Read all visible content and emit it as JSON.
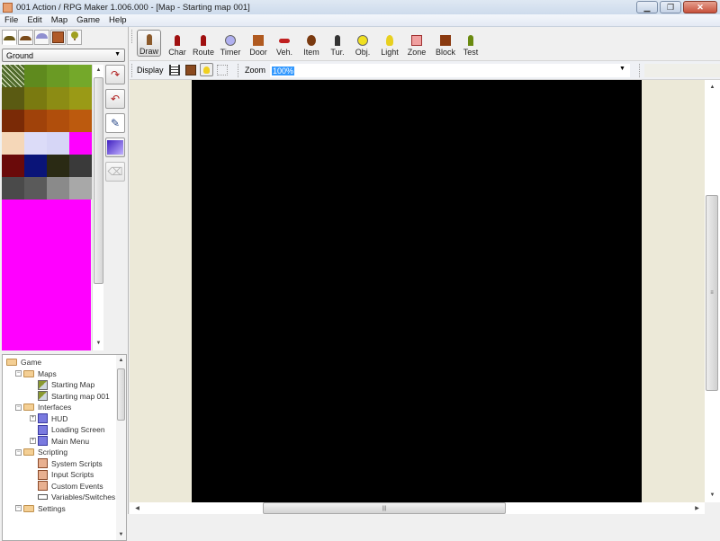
{
  "window": {
    "title": "001 Action / RPG Maker 1.006.000 - [Map - Starting map 001]",
    "minimize_icon": "minimize-icon",
    "restore_icon": "restore-icon",
    "close_icon": "close-icon"
  },
  "menu": [
    "File",
    "Edit",
    "Map",
    "Game",
    "Help"
  ],
  "left_panel": {
    "tile_tabs": [
      "ground-tab-icon",
      "hill-tab-icon",
      "platform-tab-icon",
      "wall-tab-icon",
      "tree-tab-icon"
    ],
    "layer_select": "Ground",
    "palette_colors": [
      [
        "#4f6a2a",
        "#5f8a1e",
        "#6a9a24",
        "#74a82a"
      ],
      [
        "#5a5a12",
        "#7a7a10",
        "#8c8c14",
        "#9a9a16"
      ],
      [
        "#7a2a06",
        "#a0420a",
        "#b04e0c",
        "#bc5a0e"
      ],
      [
        "#f5d7b8",
        "#dcdcf8",
        "#d6d6f6",
        "#ff00ff"
      ],
      [
        "#6a0a0a",
        "#0a1478",
        "#2a2a14",
        "#3a3a3a"
      ],
      [
        "#4a4a4a",
        "#5a5a5a",
        "#8a8a8a",
        "#a8a8a8"
      ]
    ],
    "tools": [
      "flip-horizontal-icon",
      "flip-vertical-icon",
      "pencil-icon",
      "fill-icon",
      "eraser-icon"
    ]
  },
  "tree": [
    {
      "label": "Game",
      "icon": "folder-icon",
      "level": 0,
      "expander": ""
    },
    {
      "label": "Maps",
      "icon": "folder-icon",
      "level": 1,
      "expander": "−"
    },
    {
      "label": "Starting Map",
      "icon": "map-icon",
      "level": 2,
      "expander": ""
    },
    {
      "label": "Starting map 001",
      "icon": "map-icon",
      "level": 2,
      "expander": ""
    },
    {
      "label": "Interfaces",
      "icon": "folder-icon",
      "level": 1,
      "expander": "−"
    },
    {
      "label": "HUD",
      "icon": "interface-icon",
      "level": 2,
      "expander": "+"
    },
    {
      "label": "Loading Screen",
      "icon": "interface-icon",
      "level": 2,
      "expander": ""
    },
    {
      "label": "Main Menu",
      "icon": "interface-icon",
      "level": 2,
      "expander": "+"
    },
    {
      "label": "Scripting",
      "icon": "folder-icon",
      "level": 1,
      "expander": "−"
    },
    {
      "label": "System Scripts",
      "icon": "script-icon",
      "level": 2,
      "expander": ""
    },
    {
      "label": "Input Scripts",
      "icon": "script-icon",
      "level": 2,
      "expander": ""
    },
    {
      "label": "Custom Events",
      "icon": "script-icon",
      "level": 2,
      "expander": ""
    },
    {
      "label": "Variables/Switches",
      "icon": "variables-icon",
      "level": 2,
      "expander": ""
    },
    {
      "label": "Settings",
      "icon": "folder-icon",
      "level": 1,
      "expander": "−"
    }
  ],
  "toolbar": {
    "buttons": [
      {
        "label": "Draw",
        "icon": "brush-icon",
        "active": true,
        "color": "#8b5a2b"
      },
      {
        "label": "Char",
        "icon": "character-icon",
        "active": false,
        "color": "#a01010"
      },
      {
        "label": "Route",
        "icon": "route-icon",
        "active": false,
        "color": "#a01010"
      },
      {
        "label": "Timer",
        "icon": "timer-icon",
        "active": false,
        "color": "#b0b0f0"
      },
      {
        "label": "Door",
        "icon": "door-icon",
        "active": false,
        "color": "#b05a20"
      },
      {
        "label": "Veh.",
        "icon": "vehicle-icon",
        "active": false,
        "color": "#c02020"
      },
      {
        "label": "Item",
        "icon": "item-icon",
        "active": false,
        "color": "#7a3a10"
      },
      {
        "label": "Tur.",
        "icon": "turret-icon",
        "active": false,
        "color": "#333333"
      },
      {
        "label": "Obj.",
        "icon": "object-icon",
        "active": false,
        "color": "#f0e020"
      },
      {
        "label": "Light",
        "icon": "light-icon",
        "active": false,
        "color": "#e8d020"
      },
      {
        "label": "Zone",
        "icon": "zone-icon",
        "active": false,
        "color": "#f0a0a0"
      },
      {
        "label": "Block",
        "icon": "block-icon",
        "active": false,
        "color": "#8a3a10"
      },
      {
        "label": "Test",
        "icon": "test-icon",
        "active": false,
        "color": "#6a8a10"
      }
    ]
  },
  "display_bar": {
    "label": "Display",
    "icons": [
      "film-icon",
      "background-icon",
      "lightbulb-icon",
      "grid-icon"
    ],
    "zoom_label": "Zoom",
    "zoom_value": "100%"
  },
  "colors": {
    "map_background": "#000000",
    "canvas_margin": "#ece9d8",
    "palette_empty": "#ff00ff"
  }
}
